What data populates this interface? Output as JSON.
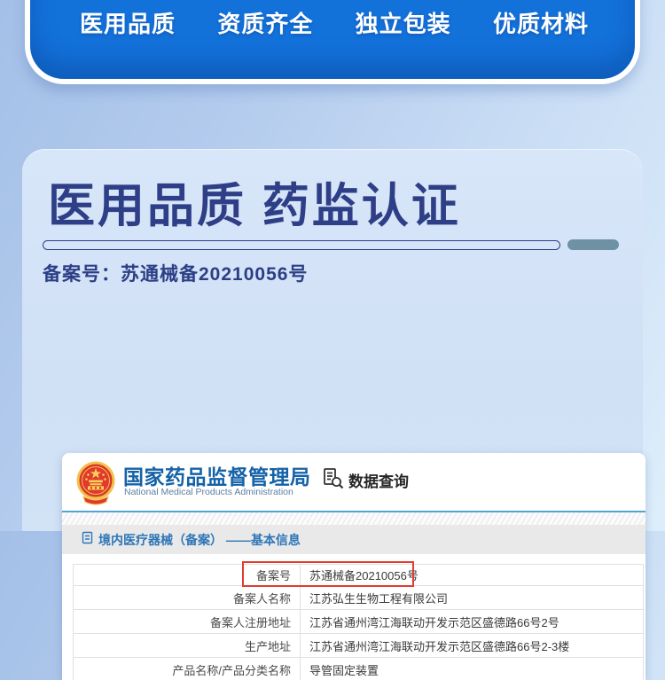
{
  "top_banner": {
    "items": [
      "医用品质",
      "资质齐全",
      "独立包装",
      "优质材料"
    ]
  },
  "section": {
    "title": "医用品质 药监认证",
    "record_number_line": "备案号：苏通械备20210056号"
  },
  "certificate": {
    "agency_name_cn": "国家药品监督管理局",
    "agency_name_en": "National Medical Products Administration",
    "query_button": "数据查询",
    "breadcrumb": "境内医疗器械（备案） ——基本信息",
    "table": {
      "rows": [
        {
          "label": "备案号",
          "value": "苏通械备20210056号"
        },
        {
          "label": "备案人名称",
          "value": "江苏弘生生物工程有限公司"
        },
        {
          "label": "备案人注册地址",
          "value": "江苏省通州湾江海联动开发示范区盛德路66号2号"
        },
        {
          "label": "生产地址",
          "value": "江苏省通州湾江海联动开发示范区盛德路66号2-3楼"
        },
        {
          "label": "产品名称/产品分类名称",
          "value": "导管固定装置"
        }
      ]
    }
  },
  "colors": {
    "banner_blue": "#1371da",
    "title_navy": "#2e3f87",
    "highlight_red": "#e23b30",
    "agency_blue": "#1562a8",
    "link_blue": "#2e75b6",
    "pill_teal": "#6e92a4"
  }
}
